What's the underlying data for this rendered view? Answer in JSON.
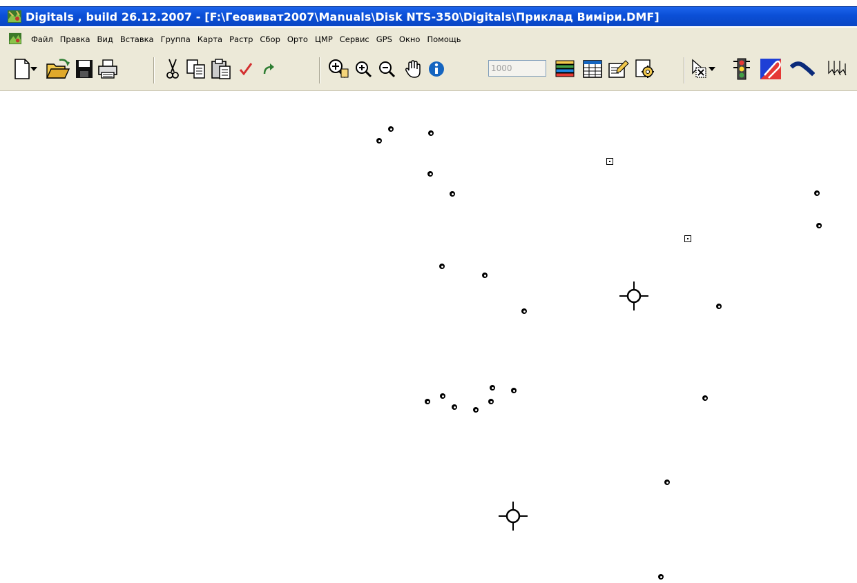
{
  "window": {
    "title": "Digitals , build 26.12.2007 - [F:\\Геовиват2007\\Manuals\\Disk NTS-350\\Digitals\\Приклад Виміри.DMF]",
    "icon": "digitals-app-icon"
  },
  "menubar": {
    "items": [
      "Файл",
      "Правка",
      "Вид",
      "Вставка",
      "Группа",
      "Карта",
      "Растр",
      "Сбор",
      "Орто",
      "ЦМР",
      "Сервис",
      "GPS",
      "Окно",
      "Помощь"
    ]
  },
  "toolbar": {
    "scale_value": "1000",
    "icons": [
      "new-document-icon",
      "new-dropdown-arrow-icon",
      "open-folder-icon",
      "save-icon",
      "print-icon",
      "cut-icon",
      "copy-icon",
      "paste-icon",
      "check-icon",
      "redo-icon",
      "zoom-window-icon",
      "zoom-in-icon",
      "zoom-out-icon",
      "pan-hand-icon",
      "info-icon",
      "layers-icon",
      "table-icon",
      "edit-form-icon",
      "settings-gear-icon",
      "select-object-icon",
      "select-dropdown-arrow-icon",
      "traffic-light-icon",
      "paper-clip-icon",
      "curve-icon",
      "arrows-icon"
    ]
  },
  "canvas": {
    "background": "#ffffff",
    "point_color": "#000000"
  },
  "colors": {
    "titlebar": "#0b4fd6",
    "menubar": "#ece9d8",
    "title_text": "#ffffff"
  }
}
